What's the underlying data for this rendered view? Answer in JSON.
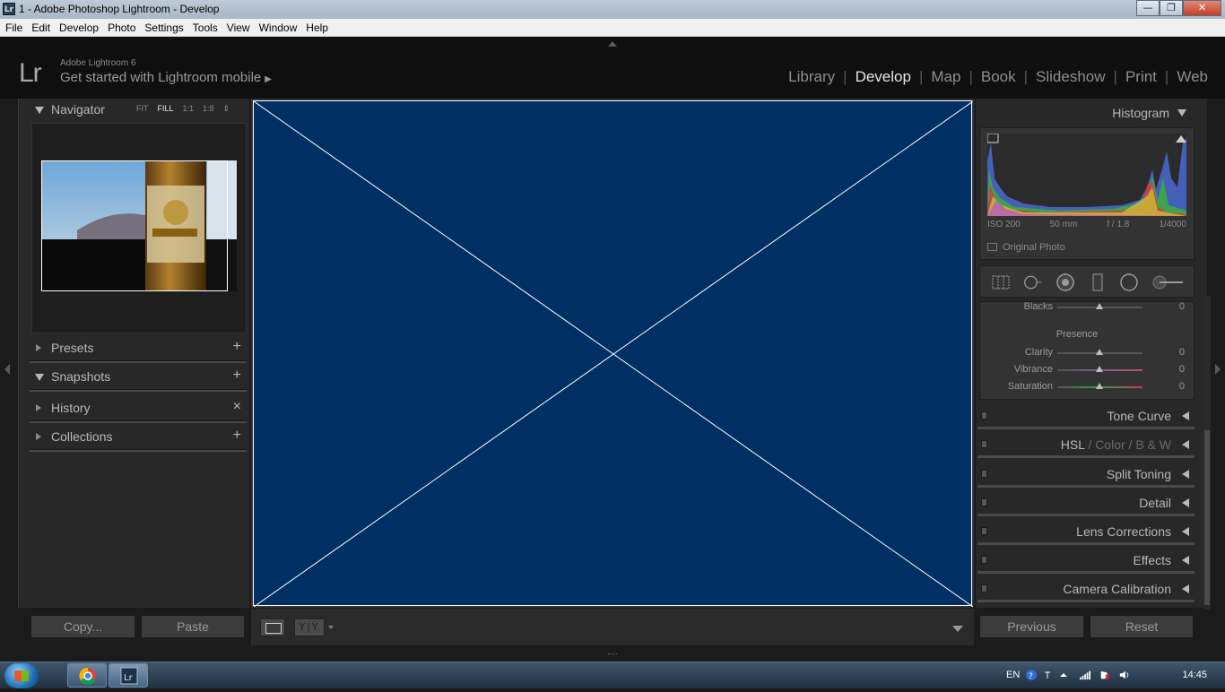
{
  "window": {
    "title": "1 - Adobe Photoshop Lightroom - Develop",
    "app_badge": "Lr",
    "minimize": "—",
    "maximize": "❐",
    "close": "✕"
  },
  "menu": [
    "File",
    "Edit",
    "Develop",
    "Photo",
    "Settings",
    "Tools",
    "View",
    "Window",
    "Help"
  ],
  "identity": {
    "logo": "Lr",
    "product": "Adobe Lightroom 6",
    "mobile_prompt": "Get started with Lightroom mobile",
    "mobile_arrow": "▶"
  },
  "modules": {
    "items": [
      "Library",
      "Develop",
      "Map",
      "Book",
      "Slideshow",
      "Print",
      "Web"
    ],
    "active": "Develop",
    "separator": "|"
  },
  "left_panel": {
    "navigator": {
      "title": "Navigator",
      "zoom_options": [
        "FIT",
        "FILL",
        "1:1",
        "1:8"
      ],
      "zoom_active": "FILL",
      "zoom_spinner": "⇕"
    },
    "presets": {
      "title": "Presets",
      "action": "+"
    },
    "snapshots": {
      "title": "Snapshots",
      "action": "+"
    },
    "history": {
      "title": "History",
      "action": "×"
    },
    "collections": {
      "title": "Collections",
      "action": "+"
    }
  },
  "left_buttons": {
    "copy": "Copy...",
    "paste": "Paste"
  },
  "center_toolbar": {
    "compare_label": "Y|Y"
  },
  "right_panel": {
    "histogram": {
      "title": "Histogram",
      "iso": "ISO 200",
      "focal": "50 mm",
      "aperture": "f / 1.8",
      "shutter": "1/4000",
      "original_photo": "Original Photo"
    },
    "basic": {
      "blacks": {
        "label": "Blacks",
        "value": "0"
      },
      "presence_title": "Presence",
      "clarity": {
        "label": "Clarity",
        "value": "0"
      },
      "vibrance": {
        "label": "Vibrance",
        "value": "0"
      },
      "saturation": {
        "label": "Saturation",
        "value": "0"
      }
    },
    "panels": {
      "tone_curve": "Tone Curve",
      "hsl": "HSL",
      "color": "Color",
      "bw": "B & W",
      "slash": "/",
      "split_toning": "Split Toning",
      "detail": "Detail",
      "lens_corrections": "Lens Corrections",
      "effects": "Effects",
      "camera_calibration": "Camera Calibration"
    }
  },
  "right_buttons": {
    "previous": "Previous",
    "reset": "Reset"
  },
  "taskbar": {
    "language": "EN",
    "clock": "14:45"
  },
  "colors": {
    "canvas": "#002f63",
    "panel_bg": "#282828",
    "active_module": "#e6e6e6"
  }
}
